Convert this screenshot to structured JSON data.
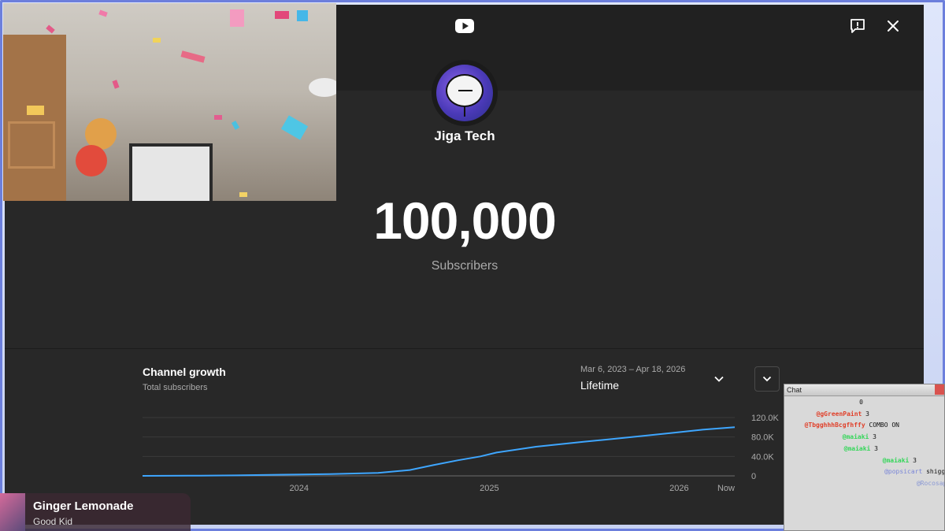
{
  "colors": {
    "dialog_bg": "#282828",
    "header_bg": "#212121",
    "chart_line": "#3ea6ff",
    "text_muted": "#aaaaaa"
  },
  "dialog": {
    "logo_icon": "youtube-icon",
    "feedback_icon": "feedback-icon",
    "close_icon": "close-icon",
    "channel_name": "Jiga Tech",
    "subscriber_count": "100,000",
    "subscriber_label": "Subscribers"
  },
  "growth": {
    "title": "Channel growth",
    "subtitle": "Total subscribers",
    "date_range": "Mar 6, 2023 – Apr 18, 2026",
    "period": "Lifetime"
  },
  "chart_data": {
    "type": "line",
    "title": "Channel growth",
    "subtitle": "Total subscribers",
    "x_tick_labels": [
      "2024",
      "2025",
      "2026",
      "Now"
    ],
    "y_tick_labels": [
      "0",
      "40.0K",
      "80.0K",
      "120.0K"
    ],
    "ylim": [
      0,
      120000
    ],
    "xlim": [
      "2023-03-06",
      "2026-04-18"
    ],
    "grid": true,
    "series": [
      {
        "values": [
          {
            "x": "2023-03-06",
            "y": 0
          },
          {
            "x": "2023-06-01",
            "y": 300
          },
          {
            "x": "2023-09-01",
            "y": 1000
          },
          {
            "x": "2023-12-01",
            "y": 2500
          },
          {
            "x": "2024-03-01",
            "y": 3500
          },
          {
            "x": "2024-06-01",
            "y": 6000
          },
          {
            "x": "2024-08-01",
            "y": 12000
          },
          {
            "x": "2024-09-15",
            "y": 22000
          },
          {
            "x": "2024-11-01",
            "y": 32000
          },
          {
            "x": "2024-12-15",
            "y": 40000
          },
          {
            "x": "2025-01-15",
            "y": 48000
          },
          {
            "x": "2025-04-01",
            "y": 60000
          },
          {
            "x": "2025-07-01",
            "y": 70000
          },
          {
            "x": "2025-09-15",
            "y": 78000
          },
          {
            "x": "2025-12-15",
            "y": 88000
          },
          {
            "x": "2026-02-15",
            "y": 95000
          },
          {
            "x": "2026-04-18",
            "y": 100000
          }
        ]
      }
    ]
  },
  "overlay": {
    "music_title": "Ginger Lemonade",
    "music_artist": "Good Kid",
    "chat_title": "Chat",
    "chat_lines": [
      {
        "user": "",
        "msg": "0",
        "style": "cu-dark"
      },
      {
        "user": "@gGreenPaint",
        "msg": "3",
        "style": "cu-red"
      },
      {
        "user": "@TbgghhhBcgfhffy",
        "msg": "COMBO ON",
        "style": "cu-red"
      },
      {
        "user": "@maiaki",
        "msg": "3",
        "style": "cu-green"
      },
      {
        "user": "@maiaki",
        "msg": "3",
        "style": "cu-green"
      },
      {
        "user": "@maiaki",
        "msg": "3",
        "style": "cu-green"
      },
      {
        "user": "@popsicart",
        "msg": "shiggy",
        "style": "cu-blue"
      },
      {
        "user": "@Rocosapie",
        "msg": "",
        "style": "cu-slate"
      }
    ]
  }
}
